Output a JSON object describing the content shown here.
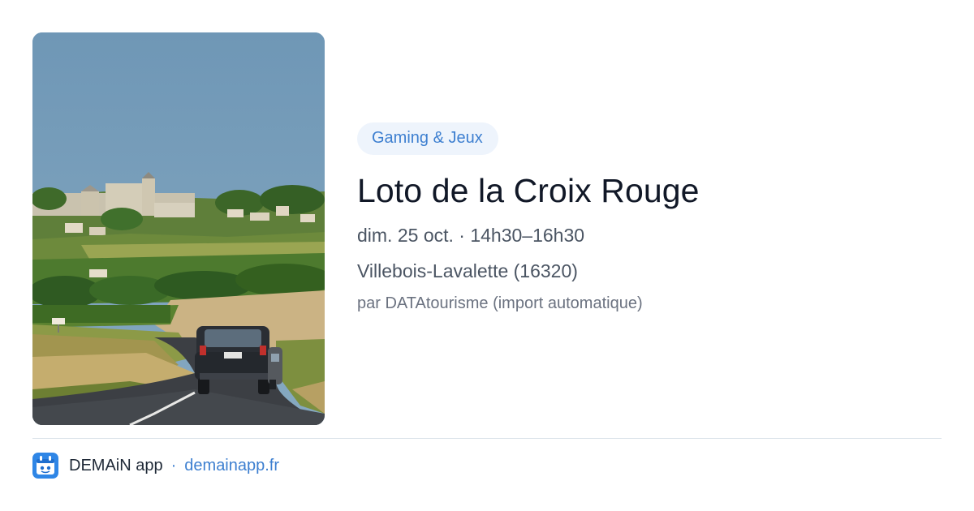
{
  "event": {
    "category": "Gaming & Jeux",
    "title": "Loto de la Croix Rouge",
    "datetime": "dim. 25 oct. · 14h30–16h30",
    "location": "Villebois-Lavalette (16320)",
    "source": "par DATAtourisme (import automatique)"
  },
  "footer": {
    "app_name": "DEMAiN app",
    "separator": "·",
    "site": "demainapp.fr"
  },
  "colors": {
    "accent": "#3d7fd0",
    "tag_background": "#eef4fc",
    "title": "#111827"
  },
  "icons": {
    "app_logo": "demain-app-logo-icon"
  }
}
